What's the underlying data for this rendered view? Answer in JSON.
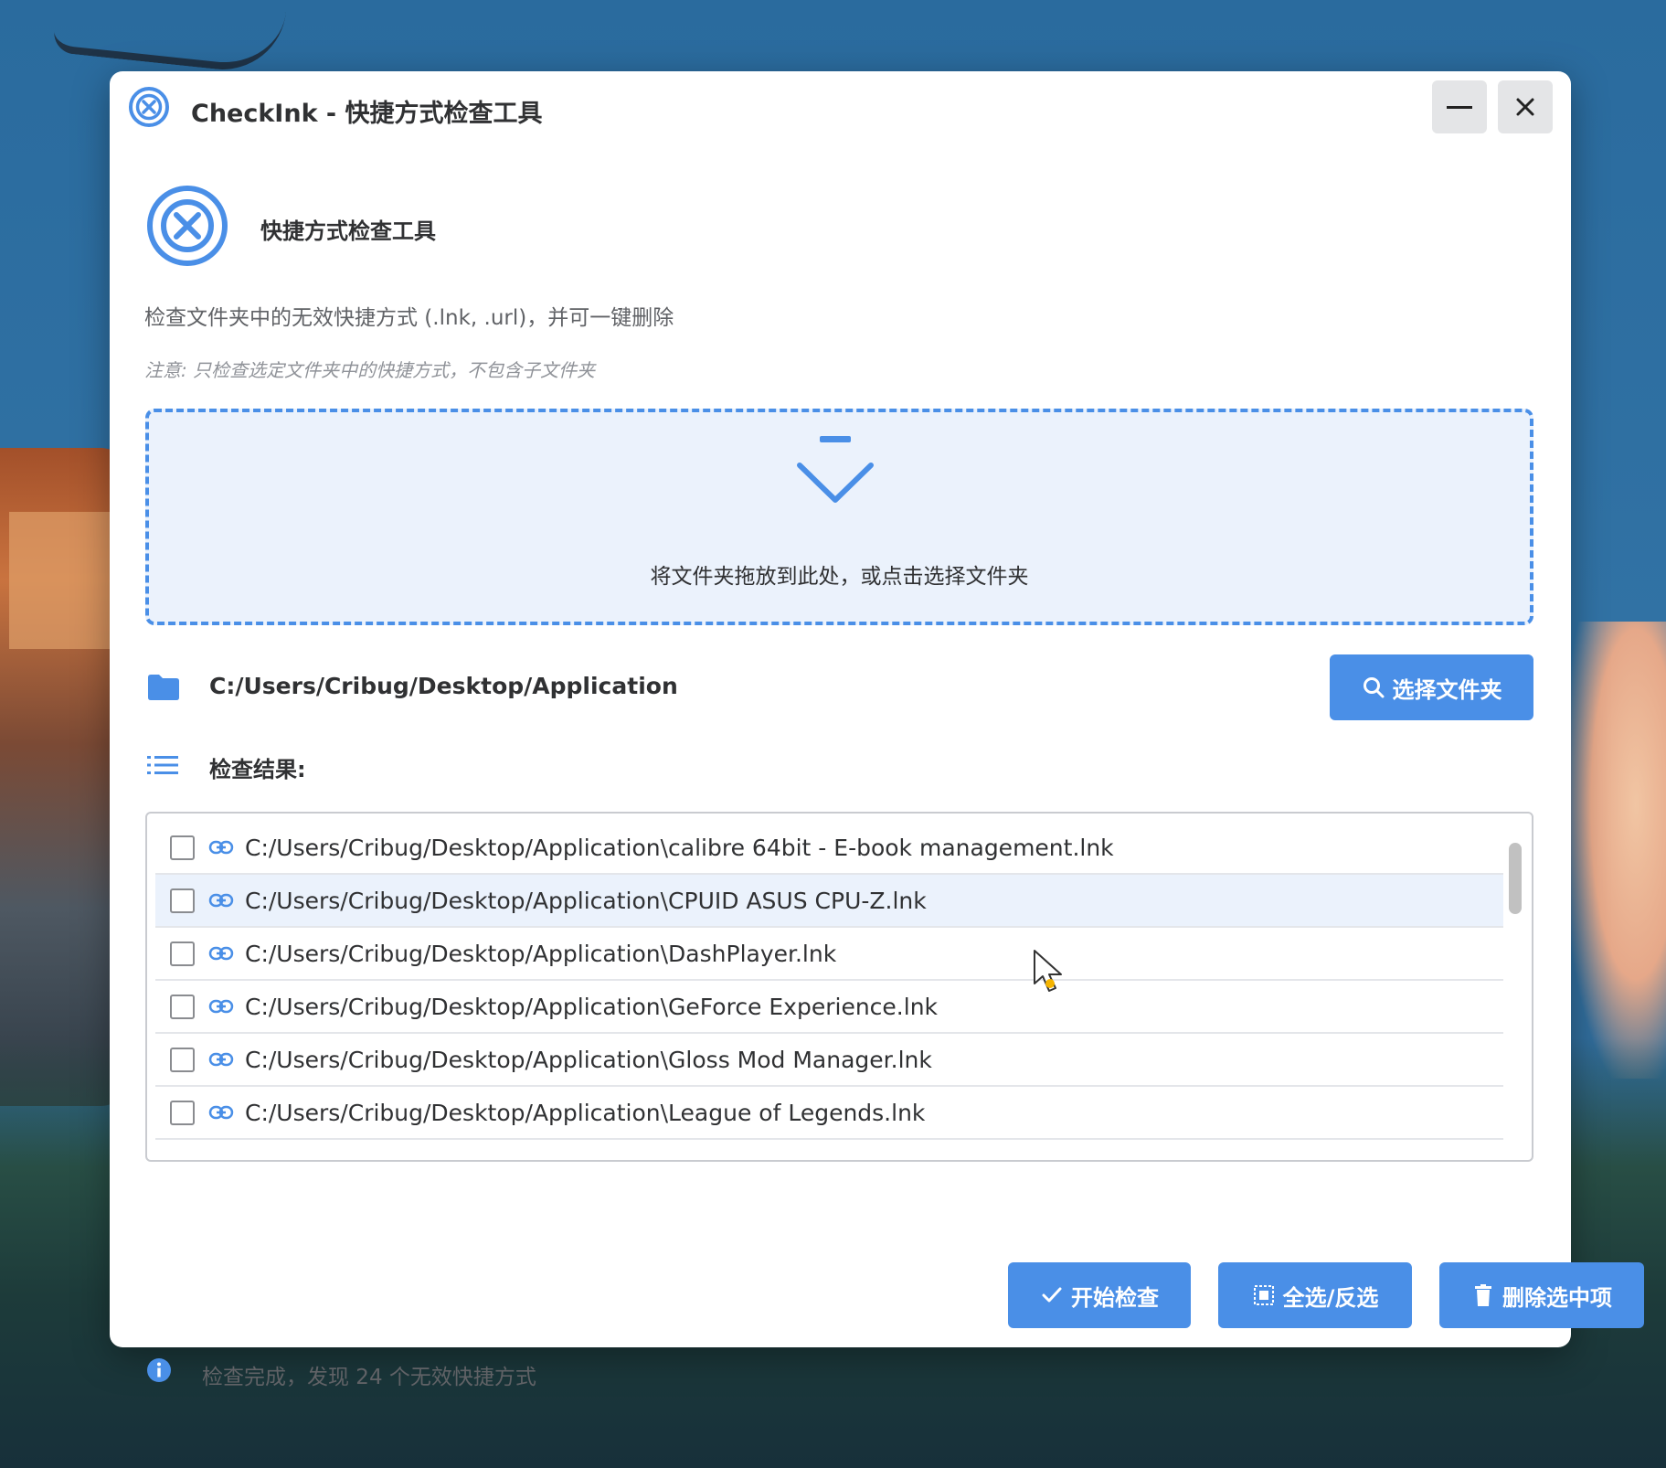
{
  "window": {
    "title": "CheckInk - 快捷方式检查工具"
  },
  "header": {
    "app_name": "快捷方式检查工具",
    "description": "检查文件夹中的无效快捷方式 (.lnk, .url)，并可一键删除",
    "note": "注意: 只检查选定文件夹中的快捷方式，不包含子文件夹"
  },
  "dropzone": {
    "text": "将文件夹拖放到此处，或点击选择文件夹"
  },
  "folder": {
    "path": "C:/Users/Cribug/Desktop/Application",
    "select_button": "选择文件夹"
  },
  "results": {
    "label": "检查结果:",
    "items": [
      {
        "text": "C:/Users/Cribug/Desktop/Application\\calibre 64bit - E-book management.lnk",
        "checked": false
      },
      {
        "text": "C:/Users/Cribug/Desktop/Application\\CPUID ASUS CPU-Z.lnk",
        "checked": false
      },
      {
        "text": "C:/Users/Cribug/Desktop/Application\\DashPlayer.lnk",
        "checked": false
      },
      {
        "text": "C:/Users/Cribug/Desktop/Application\\GeForce Experience.lnk",
        "checked": false
      },
      {
        "text": "C:/Users/Cribug/Desktop/Application\\Gloss Mod Manager.lnk",
        "checked": false
      },
      {
        "text": "C:/Users/Cribug/Desktop/Application\\League of Legends.lnk",
        "checked": false
      }
    ]
  },
  "actions": {
    "start": "开始检查",
    "select_all": "全选/反选",
    "delete": "删除选中项"
  },
  "status": {
    "text": "检查完成，发现 24 个无效快捷方式"
  },
  "colors": {
    "accent": "#4a8fe7",
    "dropzone_bg": "#ebf2fc",
    "text": "#303133",
    "muted": "#909399"
  },
  "icons": [
    "app-logo-icon",
    "minimize-icon",
    "close-icon",
    "drop-arrow-icon",
    "folder-icon",
    "search-icon",
    "list-icon",
    "link-icon",
    "check-icon",
    "select-all-icon",
    "trash-icon",
    "info-icon"
  ]
}
